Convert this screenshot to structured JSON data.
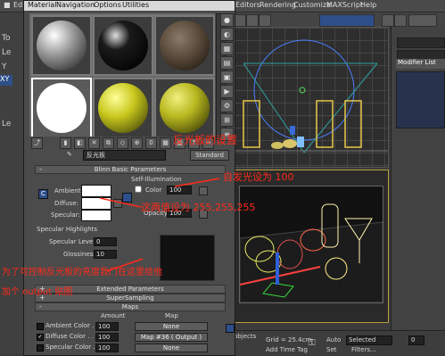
{
  "app_menu": {
    "edit": "Edit",
    "editors": "Editors",
    "rendering": "Rendering",
    "customize": "Customize",
    "maxscript": "MAXScript",
    "help": "Help"
  },
  "left_strip": {
    "labels": [
      "To",
      "Le",
      "Y",
      "Z",
      "XY",
      "Le"
    ]
  },
  "mtl_editor": {
    "menu": [
      "Material",
      "Navigation",
      "Options",
      "Utilities"
    ],
    "name": "反光板",
    "type_button": "Standard",
    "rollouts": {
      "blinn": "Blinn Basic Parameters",
      "extended": "Extended Parameters",
      "supersampling": "SuperSampling",
      "maps": "Maps"
    },
    "self_illum": {
      "group": "Self-Illumination",
      "color_label": "Color",
      "value": "100"
    },
    "ambient_label": "Ambient:",
    "diffuse_label": "Diffuse:",
    "specular_label": "Specular:",
    "opacity_label": "Opacity:",
    "opacity_value": "100",
    "lock_label": "C",
    "spec_highlights": {
      "group": "Specular Highlights",
      "level_label": "Specular Level:",
      "level_value": "0",
      "gloss_label": "Glossiness:",
      "gloss_value": "10",
      "soften_label": "Soften:",
      "soften_value": "0.1"
    },
    "maps_header": {
      "amount": "Amount",
      "map": "Map"
    },
    "maps_rows": [
      {
        "label": "Ambient Color . .",
        "amount": "100",
        "map": "None"
      },
      {
        "label": "Diffuse Color . .",
        "amount": "100",
        "map": "Map #36  ( Output )"
      },
      {
        "label": "Specular Color . .",
        "amount": "100",
        "map": "None"
      }
    ]
  },
  "command_panel": {
    "modifier_list": "Modifier List"
  },
  "status_bar": {
    "grid": "Grid = 25.4cm",
    "auto": "Auto",
    "selected": "Selected",
    "set": "Set",
    "filters": "Filters...",
    "add_time_tag": "Add Time Tag",
    "objects": "objects",
    "frame": "0"
  },
  "annotations": {
    "reflector_settings": "反光板的设置",
    "self_illum_100": "自发光设为 100",
    "values_255": "这两值设为 255,255,255",
    "output_map_1": "为了可控制反光板的亮度我门在这里给他",
    "output_map_2": "加个 output 贴图"
  },
  "colors": {
    "annotation": "#ff2a1a",
    "spheres": [
      "#9a9a9a",
      "#1a1a1a",
      "#5a4a3a",
      "#ffffff",
      "#c8c81e",
      "#b8b820"
    ]
  }
}
